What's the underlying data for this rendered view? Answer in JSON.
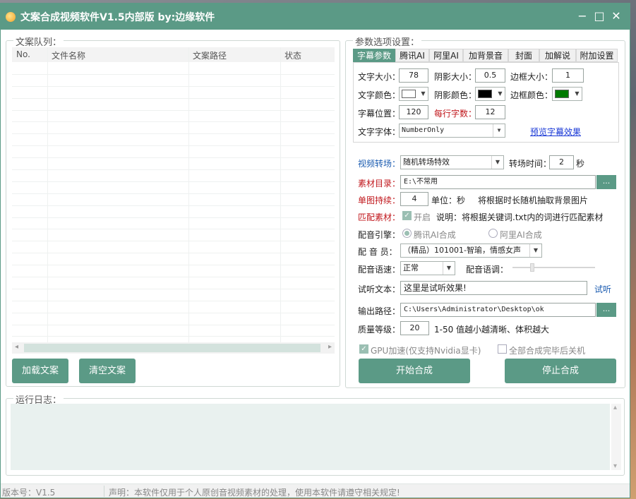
{
  "window": {
    "title": "文案合成视频软件V1.5内部版  by:边缘软件",
    "controls": {
      "minimize": "−",
      "maximize": "□",
      "close": "✕"
    }
  },
  "queue": {
    "title": "文案队列：",
    "columns": [
      "No.",
      "文件名称",
      "文案路径",
      "状态"
    ],
    "scroll_left": "◂",
    "scroll_right": "▸",
    "load_button": "加载文案",
    "clear_button": "清空文案"
  },
  "params": {
    "title": "参数选项设置：",
    "tabs": [
      "字幕参数",
      "腾讯AI",
      "阿里AI",
      "加背景音",
      "封面",
      "加解说",
      "附加设置"
    ],
    "subtitle": {
      "font_size_label": "文字大小：",
      "font_size": "78",
      "shadow_size_label": "阴影大小：",
      "shadow_size": "0.5",
      "border_size_label": "边框大小：",
      "border_size": "1",
      "font_color_label": "文字颜色：",
      "font_color": "#ffffff",
      "shadow_color_label": "阴影颜色：",
      "shadow_color": "#000000",
      "border_color_label": "边框颜色：",
      "border_color": "#007a00",
      "position_label": "字幕位置：",
      "position": "120",
      "chars_label": "每行字数：",
      "chars": "12",
      "font_label": "文字字体：",
      "font": "NumberOnly",
      "preview_link": "预览字幕效果"
    },
    "transition_label": "视频转场：",
    "transition_value": "随机转场特效",
    "transition_time_label": "转场时间：",
    "transition_time": "2",
    "seconds_unit": "秒",
    "material_dir_label": "素材目录：",
    "material_dir": "E:\\不常用",
    "browse": "...",
    "single_duration_label": "单图持续：",
    "single_duration": "4",
    "single_unit": "单位：秒",
    "single_hint": "将根据时长随机抽取背景图片",
    "match_label": "匹配素材：",
    "match_enable": "开启",
    "match_hint": "说明：将根据关键词.txt内的词进行匹配素材",
    "engine_label": "配音引擎：",
    "engine_tencent": "腾讯AI合成",
    "engine_ali": "阿里AI合成",
    "voicer_label": "配 音 员：",
    "voicer_value": "（精品）101001-智瑜，情感女声",
    "speed_label": "配音语速：",
    "speed_value": "正常",
    "tone_label": "配音语调：",
    "tone_level": 0.24,
    "test_text_label": "试听文本：",
    "test_text": "这里是试听效果!",
    "test_link": "试听",
    "output_label": "输出路径：",
    "output_path": "C:\\Users\\Administrator\\Desktop\\ok",
    "quality_label": "质量等级：",
    "quality": "20",
    "quality_hint": "1-50 值越小越清晰、体积越大",
    "gpu_label": "GPU加速(仅支持Nvidia显卡)",
    "shutdown_label": "全部合成完毕后关机",
    "start_button": "开始合成",
    "stop_button": "停止合成"
  },
  "log": {
    "title": "运行日志：",
    "scroll_up": "▴",
    "scroll_down": "▾"
  },
  "status": {
    "version": "版本号：V1.5",
    "notice": "声明：本软件仅用于个人原创音视频素材的处理，使用本软件请遵守相关规定!"
  },
  "colors": {
    "accent": "#5b9a86",
    "label_blue": "#1a5bb0",
    "label_red": "#c0161b"
  }
}
